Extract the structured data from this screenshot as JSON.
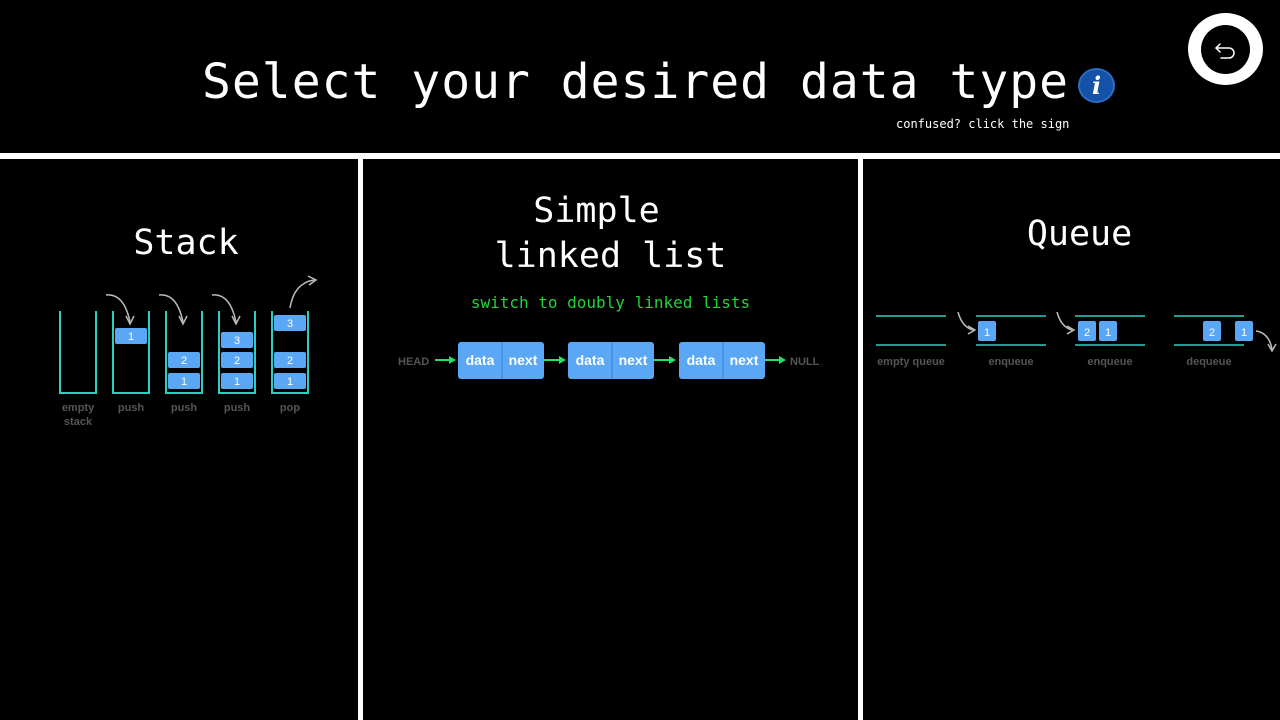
{
  "header": {
    "title": "Select your desired data type",
    "hint": "confused? click the sign",
    "info_icon": "info-icon",
    "back_icon": "back-arrow-icon"
  },
  "panels": [
    {
      "title": "Stack",
      "diagram": {
        "steps": [
          {
            "label": "empty",
            "label2": "stack",
            "items": []
          },
          {
            "label": "push",
            "items": [
              "1"
            ]
          },
          {
            "label": "push",
            "items": [
              "2",
              "1"
            ]
          },
          {
            "label": "push",
            "items": [
              "3",
              "2",
              "1"
            ]
          },
          {
            "label": "pop",
            "items": [
              "3",
              "2",
              "1"
            ]
          }
        ]
      }
    },
    {
      "title_line1": "Simple",
      "title_line2": "linked list",
      "switch_label": "switch to doubly linked lists",
      "diagram": {
        "head": "HEAD",
        "null": "NULL",
        "nodes": [
          {
            "data": "data",
            "next": "next"
          },
          {
            "data": "data",
            "next": "next"
          },
          {
            "data": "data",
            "next": "next"
          }
        ]
      }
    },
    {
      "title": "Queue",
      "diagram": {
        "steps": [
          {
            "label": "empty queue",
            "items": []
          },
          {
            "label": "enqueue",
            "items": [
              "1"
            ]
          },
          {
            "label": "enqueue",
            "items": [
              "2",
              "1"
            ]
          },
          {
            "label": "dequeue",
            "items": [
              "2",
              "1"
            ]
          }
        ]
      }
    }
  ],
  "colors": {
    "box": "#5aa7f5",
    "container": "#2ad1c0",
    "arrow_green": "#22e06a",
    "label_gray": "#555555",
    "switch_green": "#22d33a",
    "info_blue": "#1452a8"
  }
}
